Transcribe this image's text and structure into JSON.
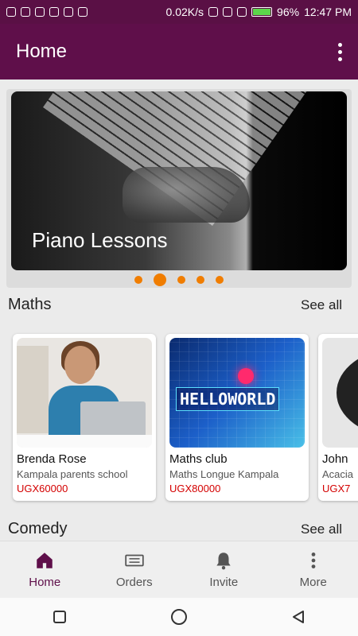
{
  "status_bar": {
    "speed": "0.02K/s",
    "battery": "96%",
    "time": "12:47 PM"
  },
  "app_bar": {
    "title": "Home"
  },
  "banner": {
    "title": "Piano Lessons",
    "slide_count": 5,
    "active_slide": 2
  },
  "sections": [
    {
      "title": "Maths",
      "see_all": "See all",
      "cards": [
        {
          "name": "Brenda Rose",
          "school": "Kampala parents school",
          "price": "UGX60000"
        },
        {
          "name": "Maths club",
          "school": "Maths Longue Kampala",
          "price": "UGX80000",
          "image_text": "HELLOWORLD"
        },
        {
          "name": "John",
          "school": "Acacia",
          "price": "UGX7"
        }
      ]
    },
    {
      "title": "Comedy",
      "see_all": "See all"
    }
  ],
  "bottom_nav": [
    {
      "label": "Home",
      "icon": "home-icon",
      "active": true
    },
    {
      "label": "Orders",
      "icon": "ticket-icon",
      "active": false
    },
    {
      "label": "Invite",
      "icon": "bell-icon",
      "active": false
    },
    {
      "label": "More",
      "icon": "more-vertical-icon",
      "active": false
    }
  ],
  "colors": {
    "primary": "#5f0f4a",
    "accent": "#f07d00",
    "price": "#d40000"
  }
}
